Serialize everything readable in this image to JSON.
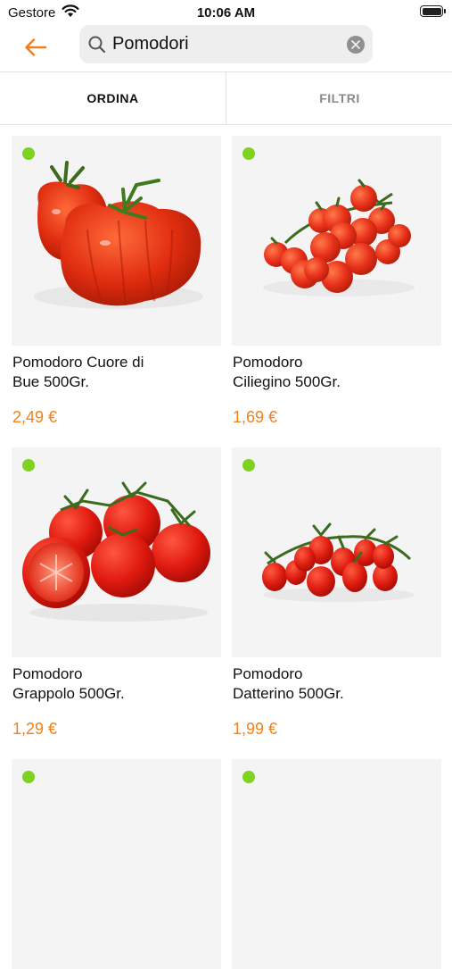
{
  "status": {
    "carrier": "Gestore",
    "time": "10:06 AM"
  },
  "search": {
    "query": "Pomodori"
  },
  "tabs": {
    "sort": "ORDINA",
    "filter": "FILTRI"
  },
  "colors": {
    "accent": "#f0801c",
    "available_dot": "#7ed321"
  },
  "products": [
    {
      "name_line1": "Pomodoro Cuore di",
      "name_line2": "Bue 500Gr.",
      "price": "2,49 €"
    },
    {
      "name_line1": "Pomodoro",
      "name_line2": "Ciliegino 500Gr.",
      "price": "1,69 €"
    },
    {
      "name_line1": "Pomodoro",
      "name_line2": "Grappolo 500Gr.",
      "price": "1,29 €"
    },
    {
      "name_line1": "Pomodoro",
      "name_line2": "Datterino 500Gr.",
      "price": "1,99 €"
    }
  ]
}
